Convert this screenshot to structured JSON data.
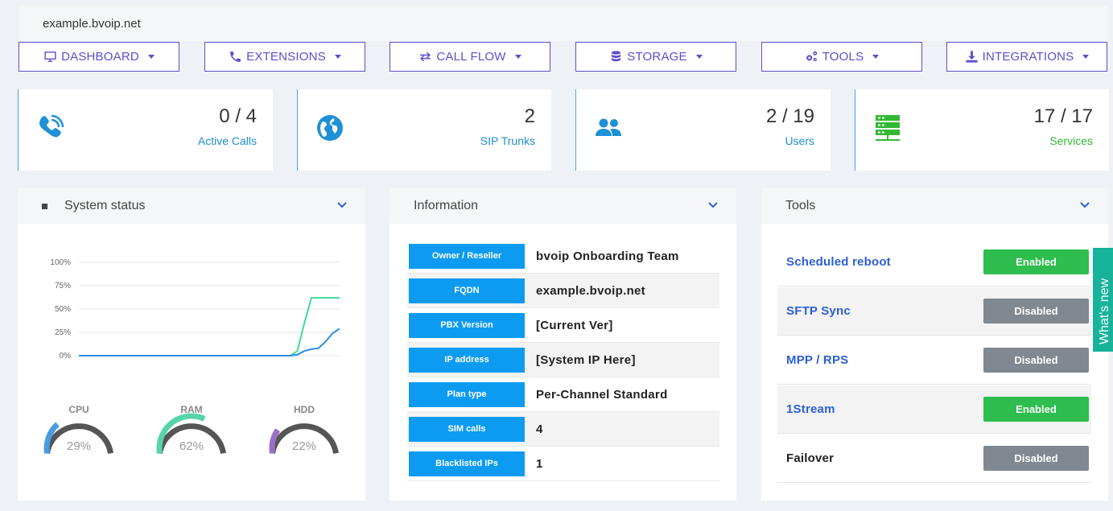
{
  "header": {
    "domain": "example.bvoip.net"
  },
  "nav": [
    {
      "label": "DASHBOARD",
      "icon": "monitor-icon"
    },
    {
      "label": "EXTENSIONS",
      "icon": "phone-icon"
    },
    {
      "label": "CALL FLOW",
      "icon": "exchange-icon"
    },
    {
      "label": "STORAGE",
      "icon": "database-icon"
    },
    {
      "label": "TOOLS",
      "icon": "cogs-icon"
    },
    {
      "label": "INTEGRATIONS",
      "icon": "download-icon"
    }
  ],
  "stats": [
    {
      "value": "0 / 4",
      "label": "Active Calls",
      "icon": "phone-volume-icon",
      "color": "#1e90d6"
    },
    {
      "value": "2",
      "label": "SIP Trunks",
      "icon": "globe-icon",
      "color": "#1e90d6"
    },
    {
      "value": "2 / 19",
      "label": "Users",
      "icon": "users-icon",
      "color": "#1e90d6"
    },
    {
      "value": "17 / 17",
      "label": "Services",
      "icon": "server-network-icon",
      "color": "#33b833"
    }
  ],
  "system_status": {
    "title": "System status",
    "chart_data": {
      "type": "line",
      "y_ticks": [
        "100%",
        "75%",
        "50%",
        "25%",
        "0%"
      ],
      "ylim": [
        0,
        100
      ],
      "series": [
        {
          "color": "#3ddc97",
          "values": [
            0,
            0,
            0,
            0,
            0,
            0,
            0,
            0,
            0,
            0,
            0,
            0,
            0,
            0,
            0,
            0,
            0,
            0,
            0,
            0,
            0,
            0,
            0,
            0,
            0,
            0,
            0,
            0,
            0,
            0,
            0,
            5,
            35,
            62,
            62,
            62,
            62,
            62
          ]
        },
        {
          "color": "#2b8be6",
          "values": [
            0,
            0,
            0,
            0,
            0,
            0,
            0,
            0,
            0,
            0,
            0,
            0,
            0,
            0,
            0,
            0,
            0,
            0,
            0,
            0,
            0,
            0,
            0,
            0,
            0,
            0,
            0,
            0,
            0,
            0,
            0,
            1,
            5,
            7,
            8,
            15,
            24,
            29
          ]
        }
      ]
    },
    "gauges": [
      {
        "label": "CPU",
        "value": "29%",
        "percent": 29,
        "color": "#4a9be0"
      },
      {
        "label": "RAM",
        "value": "62%",
        "percent": 62,
        "color": "#58d5a8"
      },
      {
        "label": "HDD",
        "value": "22%",
        "percent": 22,
        "color": "#9a6fc8"
      }
    ]
  },
  "information": {
    "title": "Information",
    "rows": [
      {
        "key": "Owner / Reseller",
        "value": "bvoip Onboarding Team"
      },
      {
        "key": "FQDN",
        "value": "example.bvoip.net"
      },
      {
        "key": "PBX Version",
        "value": "[Current Ver]"
      },
      {
        "key": "IP address",
        "value": "[System IP Here]"
      },
      {
        "key": "Plan type",
        "value": "Per-Channel Standard"
      },
      {
        "key": "SIM calls",
        "value": "4"
      },
      {
        "key": "Blacklisted IPs",
        "value": "1"
      }
    ]
  },
  "tools": {
    "title": "Tools",
    "rows": [
      {
        "name": "Scheduled reboot",
        "status": "Enabled"
      },
      {
        "name": "SFTP Sync",
        "status": "Disabled"
      },
      {
        "name": "MPP / RPS",
        "status": "Disabled"
      },
      {
        "name": "1Stream",
        "status": "Enabled"
      },
      {
        "name": "Failover",
        "status": "Disabled"
      }
    ]
  },
  "whats_new": {
    "label": "What's new"
  }
}
